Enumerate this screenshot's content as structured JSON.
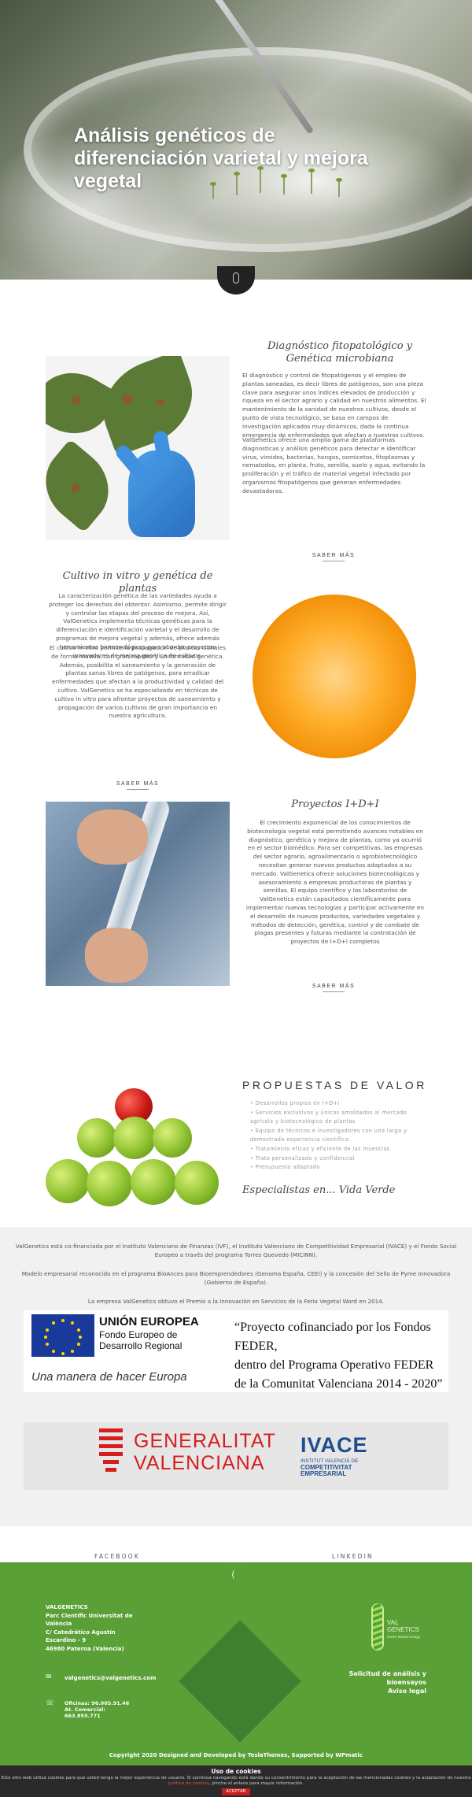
{
  "hero": {
    "title": "Análisis genéticos de diferenciación varietal y mejora vegetal"
  },
  "sections": {
    "fitopatologico": {
      "title": "Diagnóstico fitopatológico y Genética microbiana",
      "p1": "El diagnóstico y control de fitopatógenos y el empleo de plantas saneadas, es decir libres de patógenos, son una pieza clave para asegurar unos índices elevados de producción y riqueza en el sector agrario y calidad en nuestros alimentos. El mantenimiento de la sanidad de nuestros cultivos, desde el punto de vista tecnológico, se basa en campos de investigación aplicados muy dinámicos, dada la continua emergencia de enfermedades que afectan a nuestros cultivos.",
      "p2": "ValGenetics ofrece una amplia gama de plataformas diagnosticas y análisis genéticos para detectar e identificar virus, viroides, bacterias, hongos, oomicetos, fitoplasmas y nematodos, en planta, fruto, semilla, suelo y agua, evitando la proliferación y el tráfico de material vegetal infectado por organismos fitopatógenos que generan enfermedades devastadoras.",
      "more": "SABER MÁS"
    },
    "cultivo": {
      "title": "Cultivo in vitro y genética de plantas",
      "p1": "La caracterización genética de las variedades ayuda a proteger los derechos del obtentor. Asimismo, permite dirigir y controlar las etapas del proceso de mejora. Así, ValGenetics implementa técnicas genéticas para la diferenciación e identificación varietal y el desarrollo de programas de mejora vegetal y además, ofrece además herramientas biotecnológicas para abordar proyectos innovadores de mejora genética de cultivos.",
      "p2": "El cultivo in vitro permite la propagación de plantas clonales de forma masiva, con gran rapidez y uniformidad genética. Además, posibilita el saneamiento y la generación de plantas sanas libres de patógenos, para erradicar enfermedades que afectan a la productividad y calidad del cultivo. ValGenetics se ha especializado en técnicas de cultivo in vitro para afrontar proyectos de saneamiento y propagación de varios cultivos de gran importancia en nuestra agricultura.",
      "more": "SABER MÁS"
    },
    "idi": {
      "title": "Proyectos I+D+I",
      "p1": "El crecimiento exponencial de los conocimientos de biotecnología vegetal está permitiendo avances notables en diagnóstico, genética y mejora de plantas, como ya ocurrió en el sector biomédico. Para ser competitivas, las empresas del sector agrario, agroalimentario o agrobiotecnológico necesitan generar nuevos productos adaptados a su mercado. ValGenetics ofrece soluciones biotecnológicas y asesoramiento a empresas productoras de plantas y semillas. El equipo científico y los laboratorios de ValGenetics están capacitados científicamente para implementar nuevas tecnologías y participar activamente en el desarrollo de nuevos productos, variedades vegetales y métodos de detección, genética, control y de combate de plagas presentes y futuras mediante la contratación de proyectos de I+D+i completos",
      "more": "SABER MÁS"
    }
  },
  "propuestas": {
    "title": "PROPUESTAS DE VALOR",
    "items": [
      "Desarrollos propios en I+D+i",
      "Servicios exclusivos y únicos amoldados al mercado agrícola y biotecnológico de plantas",
      "Equipo de técnicos e investigadores con una larga y demostrada experiencia científica",
      "Tratamiento eficaz y eficiente de las muestras",
      "Trato personalizado y confidencial",
      "Presupuesto adaptado"
    ],
    "tagline": "Especialistas en... Vida Verde"
  },
  "financing": {
    "p1": "ValGenetics está co-financiada por el Instituto Valenciano de Finanzas (IVF), el Instituto Valenciano de Competitividad Empresarial (IVACE) y el Fondo Social Europeo a través del programa Torres Quevedo (MICINN).",
    "p2": "Modelo empresarial reconocido en el programa BioAnces para Bioemprendedores (Genoma España, CEEI) y la concesión del Sello de Pyme Innovadora (Gobierno de España).",
    "p3": "La empresa ValGenetics obtuvo el Premio a la Innovación en Servicios de la Feria Vegetal Word en 2014.",
    "eu_name": "UNIÓN EUROPEA",
    "eu_fund": "Fondo Europeo de Desarrollo Regional",
    "eu_motto": "Una manera de hacer Europa",
    "quote_l1": "“Proyecto cofinanciado por los Fondos FEDER,",
    "quote_l2": "dentro del Programa Operativo FEDER",
    "quote_l3": "de la Comunitat Valenciana 2014 - 2020”",
    "gva_l1": "GENERALITAT",
    "gva_l2": "VALENCIANA",
    "ivace": "IVACE",
    "ivace_sub1": "INSTITUT VALENCIÀ DE",
    "ivace_sub2": "COMPETITIVITAT EMPRESARIAL"
  },
  "social": {
    "facebook": "FACEBOOK",
    "linkedin": "LINKEDIN"
  },
  "footer": {
    "company": "VALGENETICS",
    "addr1": "Parc Científic Universitat de",
    "addr2": "València",
    "addr3": "C/ Catedrático Agustín",
    "addr4": "Escardino - 9",
    "addr5": "46980 Paterna (Valencia)",
    "email": "valgenetics@valgenetics.com",
    "phone1": "Oficinas: 96.005.91.46",
    "phone2": "At. Comercial:",
    "phone3": "663.855.771",
    "link1": "Solicitud de análisis y",
    "link1b": "bioensayos",
    "link2": "Aviso legal",
    "logo_l1": "VAL",
    "logo_l2": "GENETICS",
    "logo_l3": "Green Biotechnology",
    "copyright": "Copyright 2020 Designed and Developed by TeslaThemes, Supported by WPmatic"
  },
  "cookies": {
    "title": "Uso de cookies",
    "text": "Este sitio web utiliza cookies para que usted tenga la mejor experiencia de usuario. Si continúa navegando está dando su consentimiento para la aceptación de las mencionadas cookies y la aceptación de nuestra",
    "link": "política de cookies",
    "text2": ", pinche el enlace para mayor información.",
    "accept": "ACEPTAR"
  },
  "colors": {
    "footer_green": "#5aa036",
    "accent_red": "#c81e1e"
  }
}
